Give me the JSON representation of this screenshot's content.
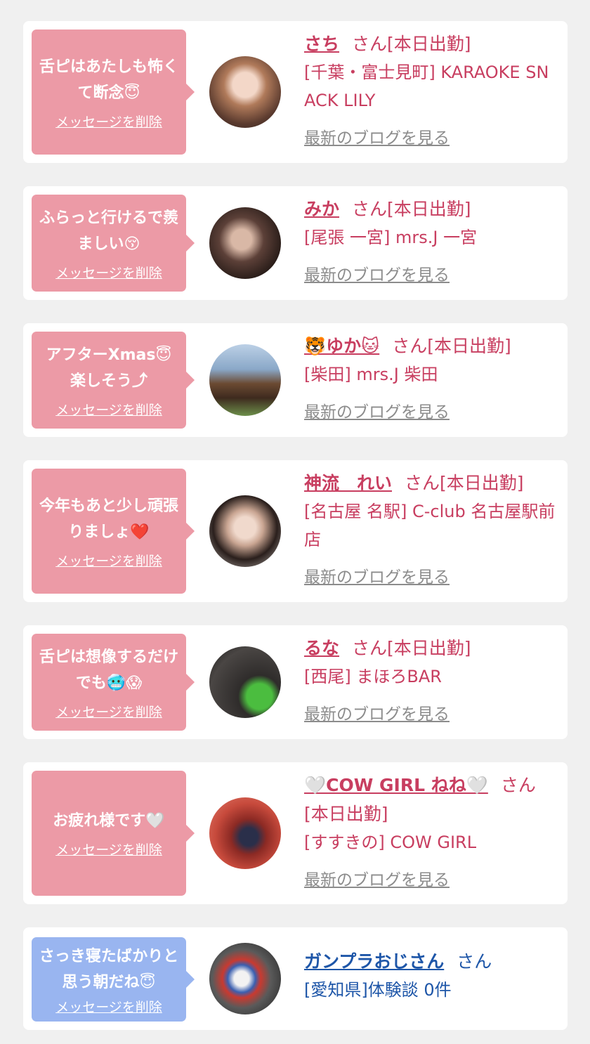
{
  "entries": [
    {
      "message": "舌ピはあたしも怖くて断念😇",
      "delete_label": "メッセージを削除",
      "name": "さち",
      "suffix": "さん[本日出勤]",
      "shop": "[千葉・富士見町] KARAOKE SNACK LILY",
      "blog_label": "最新のブログを見る",
      "theme": "pink"
    },
    {
      "message": "ふらっと行けるで羨ましい😚",
      "delete_label": "メッセージを削除",
      "name": "みか",
      "suffix": "さん[本日出勤]",
      "shop": "[尾張 一宮] mrs.J 一宮",
      "blog_label": "最新のブログを見る",
      "theme": "pink"
    },
    {
      "message": "アフターXmas😇楽しそう⤴",
      "delete_label": "メッセージを削除",
      "name": "🐯ゆか🐱",
      "suffix": "さん[本日出勤]",
      "shop": "[柴田] mrs.J 柴田",
      "blog_label": "最新のブログを見る",
      "theme": "pink"
    },
    {
      "message": "今年もあと少し頑張りましょ❤️",
      "delete_label": "メッセージを削除",
      "name": "神流　れい",
      "suffix": "さん[本日出勤]",
      "shop": "[名古屋 名駅] C-club 名古屋駅前店",
      "blog_label": "最新のブログを見る",
      "theme": "pink"
    },
    {
      "message": "舌ピは想像するだけでも🥶😱",
      "delete_label": "メッセージを削除",
      "name": "るな",
      "suffix": "さん[本日出勤]",
      "shop": "[西尾] まほろBAR",
      "blog_label": "最新のブログを見る",
      "theme": "pink"
    },
    {
      "message": "お疲れ様です🤍",
      "delete_label": "メッセージを削除",
      "name": "🤍COW GIRL ねね🤍",
      "suffix": "さん[本日出勤]",
      "shop": "[すすきの] COW GIRL",
      "blog_label": "最新のブログを見る",
      "theme": "pink"
    },
    {
      "message": "さっき寝たばかりと思う朝だね😇",
      "delete_label": "メッセージを削除",
      "name": "ガンプラおじさん",
      "suffix": "さん",
      "shop": "[愛知県]体験談 0件",
      "blog_label": "",
      "theme": "blue"
    }
  ],
  "colors": {
    "background": "#f0f0f0",
    "card": "#ffffff",
    "bubble_pink": "#ec9aa6",
    "bubble_blue": "#99b5f0",
    "name_pink": "#c83e60",
    "name_blue": "#1e56a8",
    "blog_link": "#8c8c8c"
  }
}
